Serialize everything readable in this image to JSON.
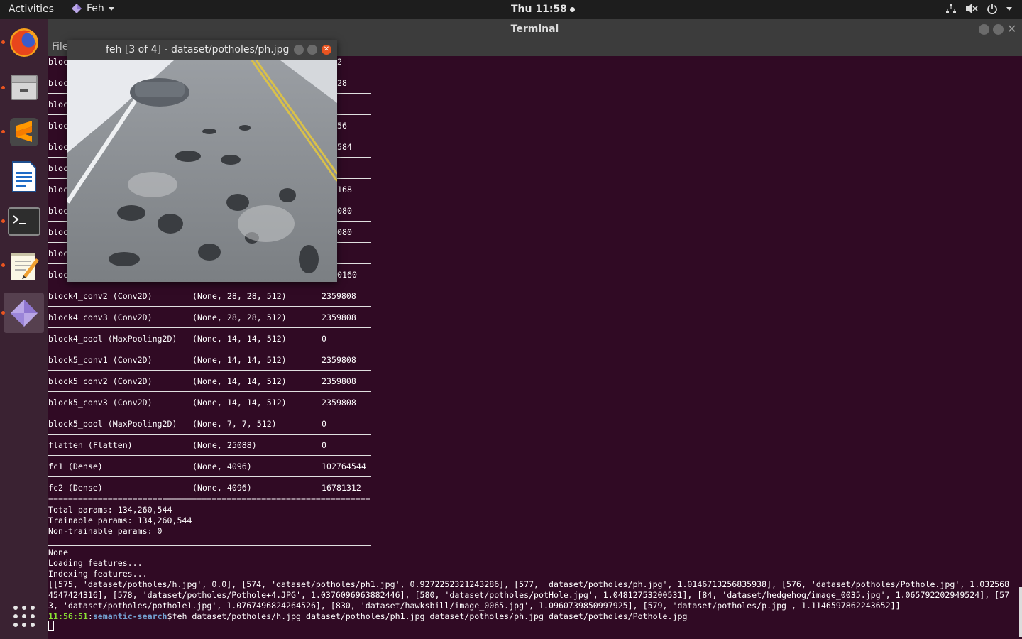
{
  "topbar": {
    "activities": "Activities",
    "app_name": "Feh",
    "clock": "Thu 11:58"
  },
  "terminal": {
    "title": "Terminal",
    "menu_file": "File",
    "hidden_rows": [
      {
        "name": "bloc",
        "params": "2"
      },
      {
        "name": "bloc",
        "params": "28"
      },
      {
        "name": "bloc",
        "params": ""
      },
      {
        "name": "bloc",
        "params": "56"
      },
      {
        "name": "bloc",
        "params": "584"
      },
      {
        "name": "bloc",
        "params": ""
      },
      {
        "name": "bloc",
        "params": "168"
      },
      {
        "name": "bloc",
        "params": "080"
      },
      {
        "name": "bloc",
        "params": "080"
      },
      {
        "name": "bloc",
        "params": ""
      },
      {
        "name": "bloc",
        "params": "0160"
      }
    ],
    "layers": [
      {
        "name": "block4_conv2 (Conv2D)",
        "shape": "(None, 28, 28, 512)",
        "params": "2359808"
      },
      {
        "name": "block4_conv3 (Conv2D)",
        "shape": "(None, 28, 28, 512)",
        "params": "2359808"
      },
      {
        "name": "block4_pool (MaxPooling2D)",
        "shape": "(None, 14, 14, 512)",
        "params": "0"
      },
      {
        "name": "block5_conv1 (Conv2D)",
        "shape": "(None, 14, 14, 512)",
        "params": "2359808"
      },
      {
        "name": "block5_conv2 (Conv2D)",
        "shape": "(None, 14, 14, 512)",
        "params": "2359808"
      },
      {
        "name": "block5_conv3 (Conv2D)",
        "shape": "(None, 14, 14, 512)",
        "params": "2359808"
      },
      {
        "name": "block5_pool (MaxPooling2D)",
        "shape": "(None, 7, 7, 512)",
        "params": "0"
      },
      {
        "name": "flatten (Flatten)",
        "shape": "(None, 25088)",
        "params": "0"
      },
      {
        "name": "fc1 (Dense)",
        "shape": "(None, 4096)",
        "params": "102764544"
      },
      {
        "name": "fc2 (Dense)",
        "shape": "(None, 4096)",
        "params": "16781312"
      }
    ],
    "double_rule": "=================================================================",
    "total_params": "Total params: 134,260,544",
    "trainable_params": "Trainable params: 134,260,544",
    "non_trainable_params": "Non-trainable params: 0",
    "none_line": "None",
    "loading": "Loading features...",
    "indexing": "Indexing features...",
    "result_line1": "[[575, 'dataset/potholes/h.jpg', 0.0], [574, 'dataset/potholes/ph1.jpg', 0.9272252321243286], [577, 'dataset/potholes/ph.jpg', 1.0146713256835938], [576, 'dataset/potholes/Pothole.jpg', 1.032568",
    "result_line2": "4547424316], [578, 'dataset/potholes/Pothole+4.JPG', 1.0376096963882446], [580, 'dataset/potholes/potHole.jpg', 1.04812753200531], [84, 'dataset/hedgehog/image_0035.jpg', 1.065792202949524], [57",
    "result_line3": "3, 'dataset/potholes/pothole1.jpg', 1.0767496824264526], [830, 'dataset/hawksbill/image_0065.jpg', 1.0960739850997925], [579, 'dataset/potholes/p.jpg', 1.1146597862243652]]",
    "prompt_time": "11:56:51",
    "prompt_sep": ":",
    "prompt_dir": "semantic-search",
    "prompt_command": "$feh dataset/potholes/h.jpg dataset/potholes/ph1.jpg dataset/potholes/ph.jpg dataset/potholes/Pothole.jpg"
  },
  "feh": {
    "title": "feh [3 of 4] - dataset/potholes/ph.jpg"
  },
  "dock": {
    "items": [
      "firefox-icon",
      "files-icon",
      "sublime-text-icon",
      "libreoffice-writer-icon",
      "terminal-icon",
      "text-editor-icon",
      "feh-icon"
    ],
    "apps_grid": "show-applications-icon"
  },
  "colors": {
    "terminal_bg": "#300a24",
    "prompt_green": "#8ae234",
    "prompt_blue": "#729fcf",
    "ubuntu_orange": "#e95420",
    "close_red": "#e95420"
  }
}
